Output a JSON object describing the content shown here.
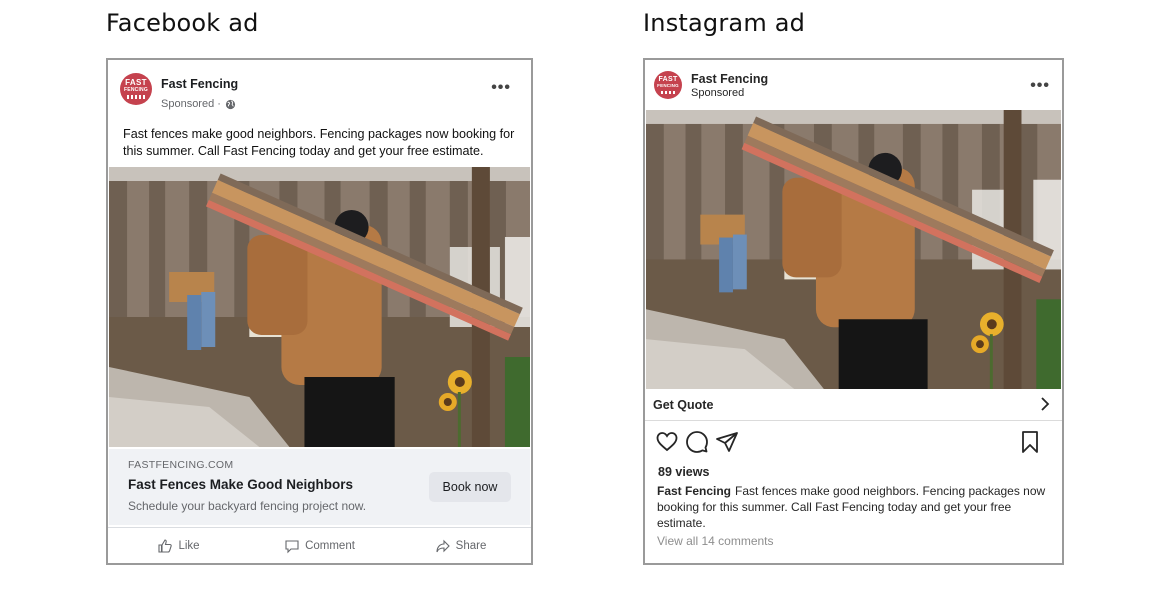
{
  "titles": {
    "facebook": "Facebook ad",
    "instagram": "Instagram ad"
  },
  "brand": {
    "name": "Fast Fencing",
    "avatar_line1": "FAST",
    "avatar_line2": "FENCING",
    "avatar_color": "#c5424e"
  },
  "facebook": {
    "sponsored": "Sponsored ·",
    "more_icon": "more-horizontal-icon",
    "post_text": "Fast fences make good neighbors. Fencing packages now booking for this summer. Call Fast Fencing today and get your free estimate.",
    "link": {
      "domain": "FASTFENCING.COM",
      "headline": "Fast Fences Make Good Neighbors",
      "description": "Schedule your backyard fencing project now.",
      "cta": "Book now"
    },
    "actions": {
      "like": "Like",
      "comment": "Comment",
      "share": "Share"
    }
  },
  "instagram": {
    "sponsored": "Sponsored",
    "cta": "Get Quote",
    "views": "89 views",
    "caption_user": "Fast Fencing",
    "caption_text": "Fast fences make good neighbors. Fencing packages now booking for this summer. Call Fast Fencing today and get your free estimate.",
    "comments_link": "View all 14 comments"
  },
  "image": {
    "subject": "Man carrying fence boards on shoulder in a backyard with sunflowers; second person working in background"
  }
}
